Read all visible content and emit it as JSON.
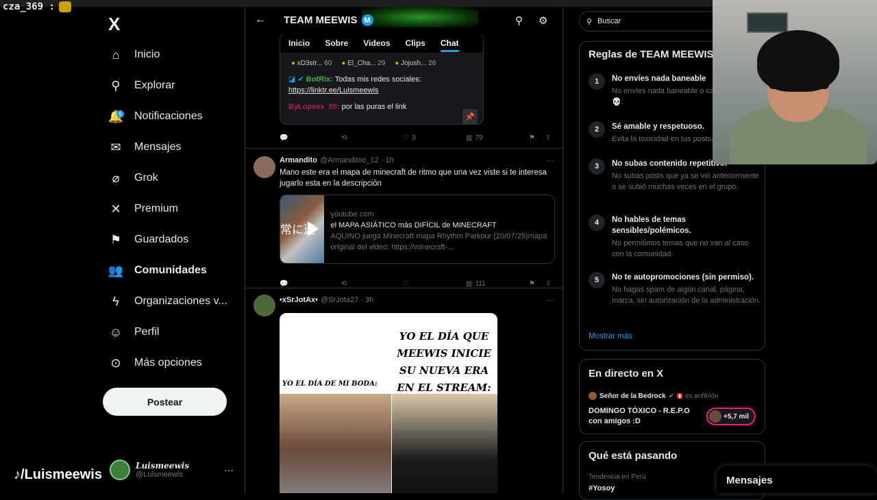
{
  "overlay": {
    "chat_user": "cza_369 :",
    "tiktok_handle": "/Luismeewis"
  },
  "nav": {
    "logo": "X",
    "items": [
      {
        "icon": "home-icon",
        "glyph": "⌂",
        "label": "Inicio"
      },
      {
        "icon": "search-icon",
        "glyph": "⚲",
        "label": "Explorar"
      },
      {
        "icon": "bell-icon",
        "glyph": "🔔",
        "label": "Notificaciones",
        "badge": "6"
      },
      {
        "icon": "mail-icon",
        "glyph": "✉",
        "label": "Mensajes"
      },
      {
        "icon": "grok-icon",
        "glyph": "⌀",
        "label": "Grok"
      },
      {
        "icon": "x-premium-icon",
        "glyph": "✕",
        "label": "Premium"
      },
      {
        "icon": "bookmark-icon",
        "glyph": "⚑",
        "label": "Guardados"
      },
      {
        "icon": "communities-icon",
        "glyph": "👥",
        "label": "Comunidades"
      },
      {
        "icon": "lightning-icon",
        "glyph": "ϟ",
        "label": "Organizaciones v..."
      },
      {
        "icon": "profile-icon",
        "glyph": "☺",
        "label": "Perfil"
      },
      {
        "icon": "more-circle-icon",
        "glyph": "⊙",
        "label": "Más opciones"
      }
    ],
    "post_button": "Postear",
    "user": {
      "name": "Luismeewis",
      "handle": "@Luismeewis"
    }
  },
  "community": {
    "title": "TEAM MEEWIS",
    "badge": "M",
    "tabs": [
      "Inicio",
      "Sobre",
      "Videos",
      "Clips",
      "Chat"
    ],
    "active_tab": "Chat",
    "chat_users": [
      {
        "name": "xD3str...",
        "count": "60"
      },
      {
        "name": "El_Cha...",
        "count": "29"
      },
      {
        "name": "Jojosh...",
        "count": "26"
      }
    ],
    "bot_name": "BotRix:",
    "bot_msg": "Todas mis redes sociales:",
    "bot_link": "https://linktr.ee/Luismeewis",
    "chat_user2": "ByLopexx_05:",
    "chat_msg2": "por las puras el link",
    "actions1": {
      "likes": "3",
      "views": "79"
    }
  },
  "post1": {
    "name": "Armandito",
    "handle": "@Armanditoo_12 · 1h",
    "text": "Mano este era el mapa de minecraft de ritmo que una vez viste si te interesa jugarlo esta en la descripción",
    "card": {
      "thumb_text": "常に迷",
      "domain": "youtube.com",
      "title": "el MAPA ASIÁTICO más DIFÍCIL de MINECRAFT",
      "desc": "AQUINO juega Minecraft mapa Rhythm Parkour (20/07/25)mapa original del video: https://minecraft-..."
    },
    "views": "111"
  },
  "post2": {
    "name": "•xSrJotAx•",
    "handle": "@SrJota27 · 3h",
    "meme_big": "YO EL DÍA QUE MEEWIS INICIE SU NUEVA ERA EN EL STREAM:",
    "meme_small": "YO EL DÍA DE MI BODA:"
  },
  "right": {
    "search_placeholder": "Buscar",
    "rules_title": "Reglas de TEAM MEEWIS",
    "rules": [
      {
        "n": "1",
        "h": "No envíes nada baneable",
        "d": "No envíes nada baneable o calavera 💀💀💀."
      },
      {
        "n": "2",
        "h": "Sé amable y respetuoso.",
        "d": "Evita la toxicidad en tus posts."
      },
      {
        "n": "3",
        "h": "No subas contenido repetitivo.",
        "d": "No subas posts que ya se vió anteriormente o se subió muchas veces en el grupo."
      },
      {
        "n": "4",
        "h": "No hables de temas sensibles/polémicos.",
        "d": "No permitimos temas que no van al caso con la comunidad."
      },
      {
        "n": "5",
        "h": "No te autopromociones (sin permiso).",
        "d": "No hagas spam de algún canal, página, marca, sin autorización de la administración."
      }
    ],
    "show_more": "Mostrar más",
    "live_title": "En directo en X",
    "live_host": "Señor de la Bedrock",
    "live_host_tag": "es anfitrión",
    "live_stream_title": "DOMINGO TÓXICO - R.E.P.O con amigos :D",
    "live_count": "+5,7 mil",
    "trends_title": "Qué está pasando",
    "trend_location": "Tendencia en Perú",
    "trend_value": "#Yosoy",
    "messages": "Mensajes"
  }
}
